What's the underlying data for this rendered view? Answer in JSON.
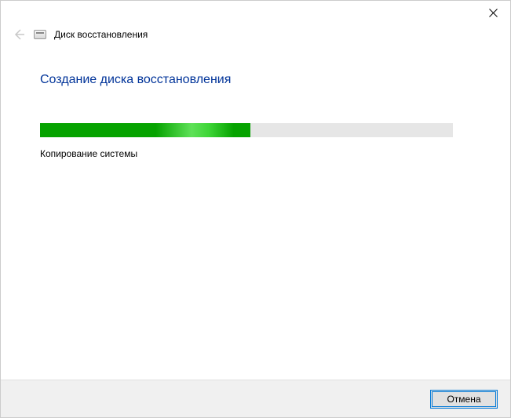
{
  "window": {
    "title": "Диск восстановления"
  },
  "content": {
    "heading": "Создание диска восстановления",
    "status": "Копирование системы",
    "progress_percent": 51
  },
  "footer": {
    "cancel_label": "Отмена"
  },
  "icons": {
    "close": "✕",
    "back": "←",
    "drive": "drive-icon"
  }
}
